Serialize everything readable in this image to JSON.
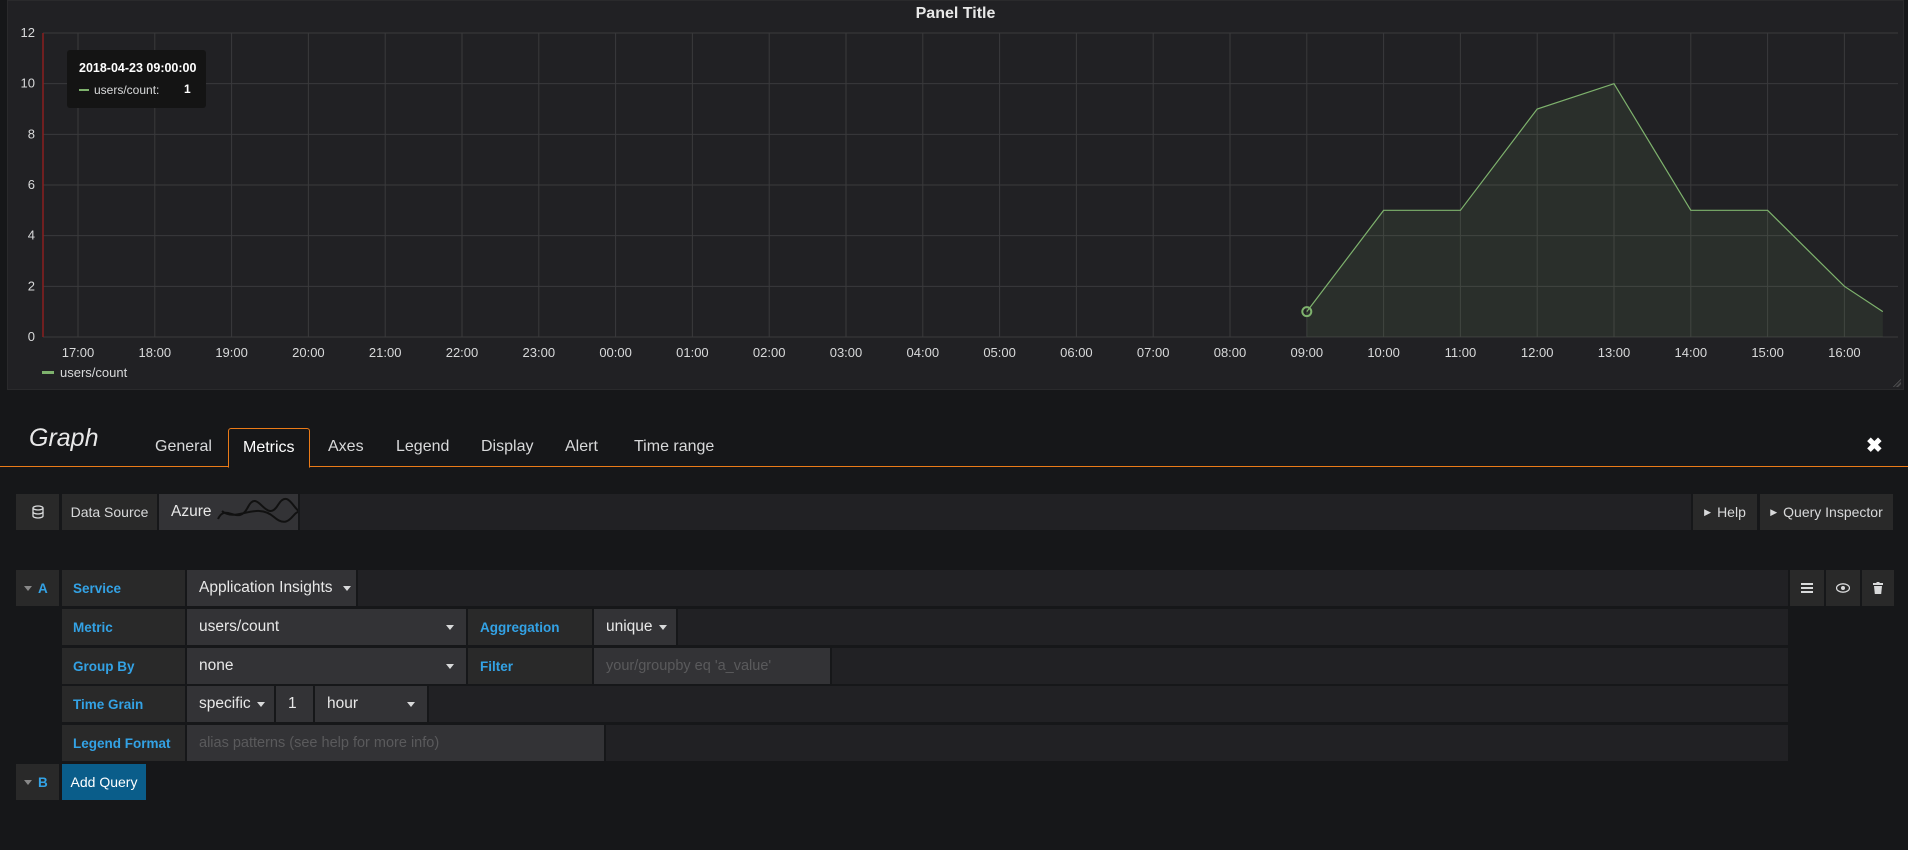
{
  "panel": {
    "title": "Panel Title",
    "legend": "users/count",
    "tooltip": {
      "time": "2018-04-23 09:00:00",
      "series": "users/count:",
      "value": "1"
    }
  },
  "chart_data": {
    "type": "area",
    "title": "Panel Title",
    "x_ticks": [
      "17:00",
      "18:00",
      "19:00",
      "20:00",
      "21:00",
      "22:00",
      "23:00",
      "00:00",
      "01:00",
      "02:00",
      "03:00",
      "04:00",
      "05:00",
      "06:00",
      "07:00",
      "08:00",
      "09:00",
      "10:00",
      "11:00",
      "12:00",
      "13:00",
      "14:00",
      "15:00",
      "16:00"
    ],
    "y_ticks": [
      0,
      2,
      4,
      6,
      8,
      10,
      12
    ],
    "ylim": [
      0,
      12
    ],
    "series": [
      {
        "name": "users/count",
        "color": "#7eb26d",
        "x": [
          "09:00",
          "10:00",
          "11:00",
          "12:00",
          "13:00",
          "14:00",
          "15:00",
          "16:00",
          "16:30"
        ],
        "values": [
          1,
          5,
          5,
          9,
          10,
          5,
          5,
          2,
          1
        ]
      }
    ],
    "highlight": {
      "x": "09:00",
      "value": 1
    },
    "grid": true,
    "legend_position": "bottom-left"
  },
  "editor": {
    "title": "Graph",
    "tabs": [
      "General",
      "Metrics",
      "Axes",
      "Legend",
      "Display",
      "Alert",
      "Time range"
    ],
    "active_tab": "Metrics",
    "datasource_label": "Data Source",
    "datasource_value": "Azure",
    "help": "Help",
    "query_inspector": "Query Inspector"
  },
  "query_a": {
    "ref": "A",
    "service_label": "Service",
    "service_value": "Application Insights",
    "metric_label": "Metric",
    "metric_value": "users/count",
    "aggregation_label": "Aggregation",
    "aggregation_value": "unique",
    "groupby_label": "Group By",
    "groupby_value": "none",
    "filter_label": "Filter",
    "filter_placeholder": "your/groupby eq 'a_value'",
    "timegrain_label": "Time Grain",
    "timegrain_mode": "specific",
    "timegrain_number": "1",
    "timegrain_unit": "hour",
    "legend_format_label": "Legend Format",
    "legend_format_placeholder": "alias patterns (see help for more info)"
  },
  "query_b": {
    "ref": "B",
    "add_query": "Add Query"
  },
  "colors": {
    "accent": "#eb7b18",
    "label": "#33a2e5",
    "series": "#7eb26d",
    "primary": "#0a5d8a"
  }
}
